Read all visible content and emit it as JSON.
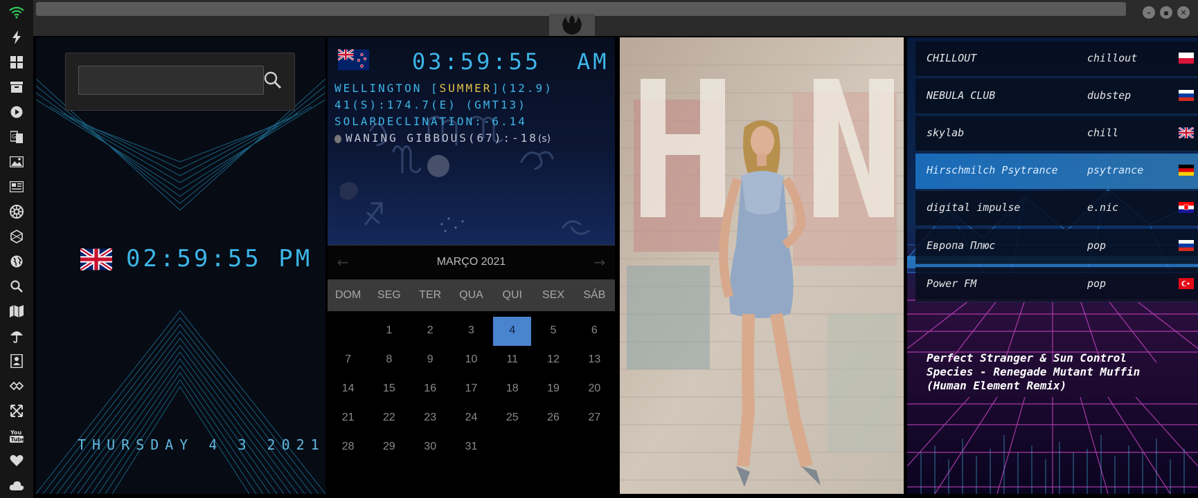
{
  "sidebar": {
    "icons": [
      "wifi-icon",
      "lightning-icon",
      "windows-icon",
      "archive-icon",
      "play-icon",
      "translate-icon",
      "image-icon",
      "news-icon",
      "empire-icon",
      "hexagon-icon",
      "globe-icon",
      "search-icon",
      "map-icon",
      "umbrella-icon",
      "contacts-icon",
      "game-icon",
      "expand-icon",
      "youtube-icon",
      "heart-icon",
      "cloud-icon"
    ]
  },
  "search": {
    "placeholder": "",
    "value": ""
  },
  "local_clock": {
    "time": "02:59:55 PM",
    "date": "THURSDAY 4 3 2021"
  },
  "world_clock": {
    "time": "03:59:55",
    "ampm": "AM",
    "city": "WELLINGTON [",
    "season": "SUMMER",
    "uv": "](12.9)",
    "coords": "41(S):174.7(E) (GMT13)",
    "solar": "SOLARDECLINATION:-6.14",
    "moon": "WANING GIBBOUS(67):-18",
    "moon_unit": "(s)"
  },
  "calendar": {
    "title": "MARÇO 2021",
    "prev": "←",
    "next": "→",
    "weekdays": [
      "DOM",
      "SEG",
      "TER",
      "QUA",
      "QUI",
      "SEX",
      "SÁB"
    ],
    "leading_blanks": 1,
    "days": [
      1,
      2,
      3,
      4,
      5,
      6,
      7,
      8,
      9,
      10,
      11,
      12,
      13,
      14,
      15,
      16,
      17,
      18,
      19,
      20,
      21,
      22,
      23,
      24,
      25,
      26,
      27,
      28,
      29,
      30,
      31
    ],
    "today": 4
  },
  "radio": {
    "stations": [
      {
        "name": "CHILLOUT",
        "genre": "chillout",
        "flag": "poland"
      },
      {
        "name": "NEBULA CLUB",
        "genre": "dubstep",
        "flag": "russia"
      },
      {
        "name": "skylab",
        "genre": "chill",
        "flag": "uk"
      },
      {
        "name": "Hirschmilch Psytrance",
        "genre": "psytrance",
        "flag": "germany",
        "active": true
      },
      {
        "name": "digital impulse",
        "genre": "e.nic",
        "flag": "croatia"
      },
      {
        "name": "Европа Плюс",
        "genre": "pop",
        "flag": "russia"
      },
      {
        "name": "Power FM",
        "genre": "pop",
        "flag": "turkey"
      }
    ],
    "now_playing": [
      "Perfect Stranger & Sun Control",
      "Species - Renegade Mutant Muffin",
      "(Human Element Remix)"
    ]
  },
  "colors": {
    "lcd": "#3db6e8",
    "accent_yellow": "#e2c14a",
    "today": "#4a84cf"
  }
}
